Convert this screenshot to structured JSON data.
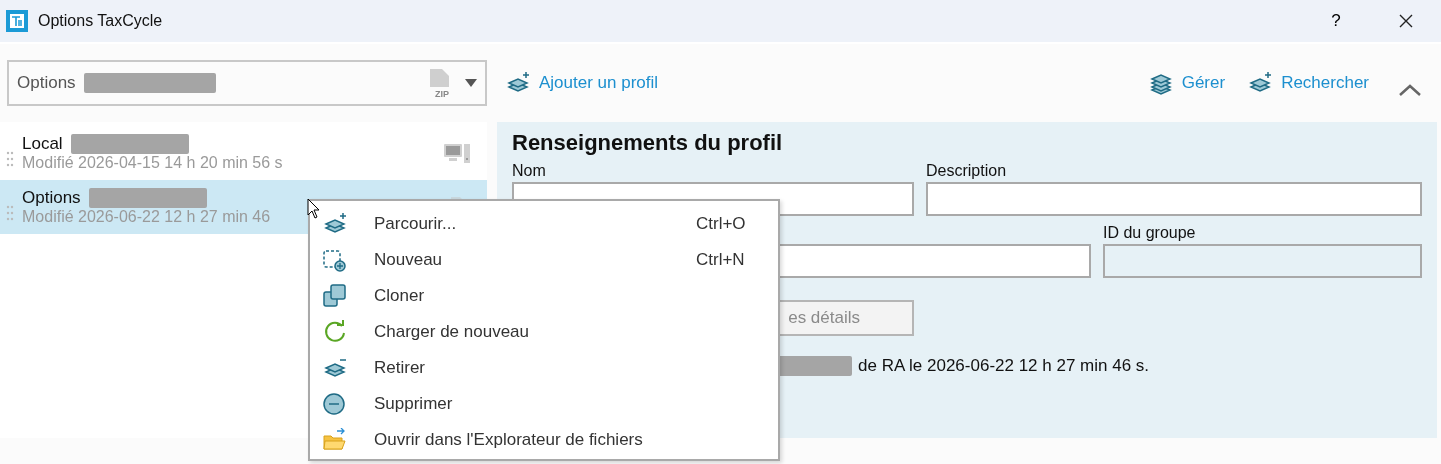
{
  "window": {
    "title": "Options TaxCycle",
    "help": "?"
  },
  "selector": {
    "value": "Options",
    "redacted": true,
    "file_type": "ZIP"
  },
  "toolbar": [
    {
      "label": "Ajouter un profil",
      "kind": "add"
    },
    {
      "label": "Gérer",
      "kind": "manage"
    },
    {
      "label": "Rechercher",
      "kind": "search"
    }
  ],
  "profiles": [
    {
      "name": "Local",
      "redacted": true,
      "modified": "Modifié 2026-04-15 14 h 20 min 56 s",
      "selected": false,
      "kind": "computer"
    },
    {
      "name": "Options",
      "redacted": true,
      "modified": "Modifié 2026-06-22 12 h 27 min 46",
      "selected": true,
      "kind": "file"
    }
  ],
  "details": {
    "title": "Renseignements du profil",
    "fields": [
      {
        "label": "Nom",
        "disabled": false
      },
      {
        "label": "Description",
        "disabled": false
      },
      {
        "disabled": false
      },
      {
        "label": "ID du groupe",
        "disabled": true
      }
    ],
    "button": "es détails",
    "note": "de RA le 2026-06-22 12 h 27 min 46 s.",
    "note_redacted": true
  },
  "context_menu": [
    {
      "label": "Parcourir...",
      "shortcut": "Ctrl+O",
      "kind": "browse"
    },
    {
      "label": "Nouveau",
      "shortcut": "Ctrl+N",
      "kind": "new"
    },
    {
      "label": "Cloner",
      "kind": "clone"
    },
    {
      "label": "Charger de nouveau",
      "kind": "reload"
    },
    {
      "label": "Retirer",
      "kind": "remove"
    },
    {
      "label": "Supprimer",
      "kind": "delete"
    },
    {
      "label": "Ouvrir dans l'Explorateur de fichiers",
      "kind": "folder"
    }
  ]
}
